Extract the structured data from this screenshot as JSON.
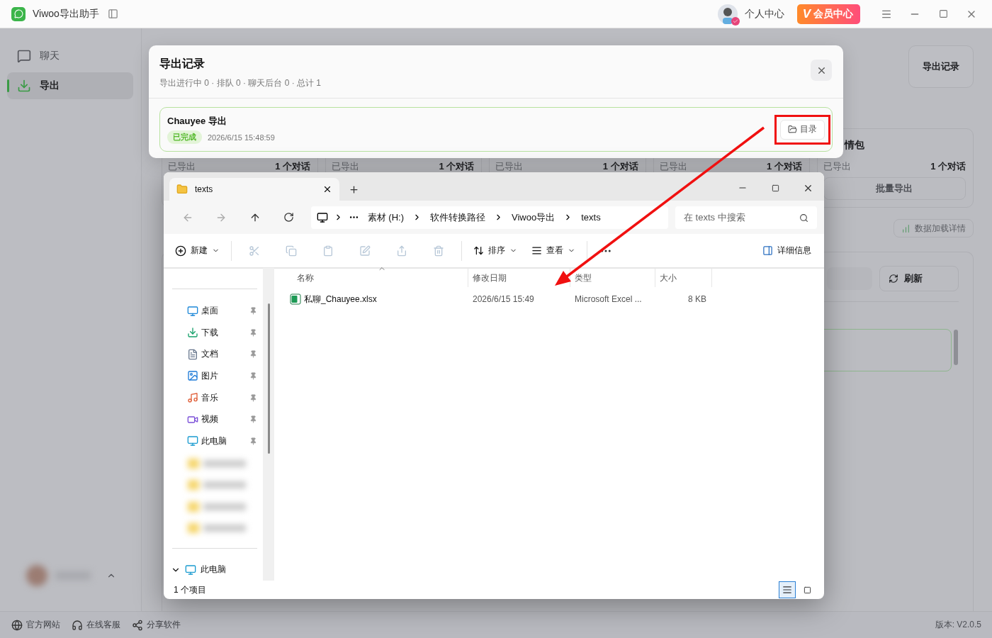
{
  "app": {
    "title": "Viwoo导出助手"
  },
  "header": {
    "profile_label": "个人中心",
    "vip": {
      "logo": "V",
      "label": "会员中心"
    }
  },
  "sidebar": {
    "items": [
      {
        "label": "聊天",
        "selected": false
      },
      {
        "label": "导出",
        "selected": true
      }
    ]
  },
  "main": {
    "record_button": "导出记录",
    "cards": [
      {
        "stat_label": "已导出",
        "stat_value": "1 个对话"
      },
      {
        "stat_label": "已导出",
        "stat_value": "1 个对话"
      },
      {
        "stat_label": "已导出",
        "stat_value": "1 个对话"
      },
      {
        "stat_label": "已导出",
        "stat_value": "1 个对话"
      },
      {
        "title": "情包",
        "stat_label": "已导出",
        "stat_value": "1 个对话",
        "action": "批量导出"
      }
    ],
    "details_button": "数据加载详情",
    "refresh_button": "刷新"
  },
  "footer": {
    "links": [
      {
        "label": "官方网站"
      },
      {
        "label": "在线客服"
      },
      {
        "label": "分享软件"
      }
    ],
    "version": "版本: V2.0.5"
  },
  "export_dialog": {
    "title": "导出记录",
    "summary": "导出进行中 0 · 排队 0 · 聊天后台 0 · 总计 1",
    "records": [
      {
        "name": "Chauyee 导出",
        "status": "已完成",
        "time": "2026/6/15 15:48:59",
        "action": "目录",
        "highlighted": true
      }
    ]
  },
  "explorer": {
    "tabs": [
      {
        "label": "texts",
        "selected": true
      }
    ],
    "breadcrumb": [
      "素材 (H:)",
      "软件转换路径",
      "Viwoo导出",
      "texts"
    ],
    "search": {
      "placeholder": "在 texts 中搜索"
    },
    "toolbar": {
      "new": "新建",
      "sort": "排序",
      "view": "查看",
      "details": "详细信息"
    },
    "nav": [
      {
        "label": "桌面",
        "pinned": true
      },
      {
        "label": "下载",
        "pinned": true
      },
      {
        "label": "文档",
        "pinned": true
      },
      {
        "label": "图片",
        "pinned": true
      },
      {
        "label": "音乐",
        "pinned": true
      },
      {
        "label": "视频",
        "pinned": true
      },
      {
        "label": "此电脑",
        "pinned": true
      }
    ],
    "nav_root": {
      "label": "此电脑",
      "expanded": true
    },
    "columns": [
      "名称",
      "修改日期",
      "类型",
      "大小"
    ],
    "files": [
      {
        "name": "私聊_Chauyee.xlsx",
        "modified": "2026/6/15 15:49",
        "type": "Microsoft Excel ...",
        "size": "8 KB"
      }
    ],
    "status": "1 个项目",
    "view_modes": [
      {
        "kind": "details",
        "selected": true
      },
      {
        "kind": "tiles",
        "selected": false
      }
    ]
  }
}
